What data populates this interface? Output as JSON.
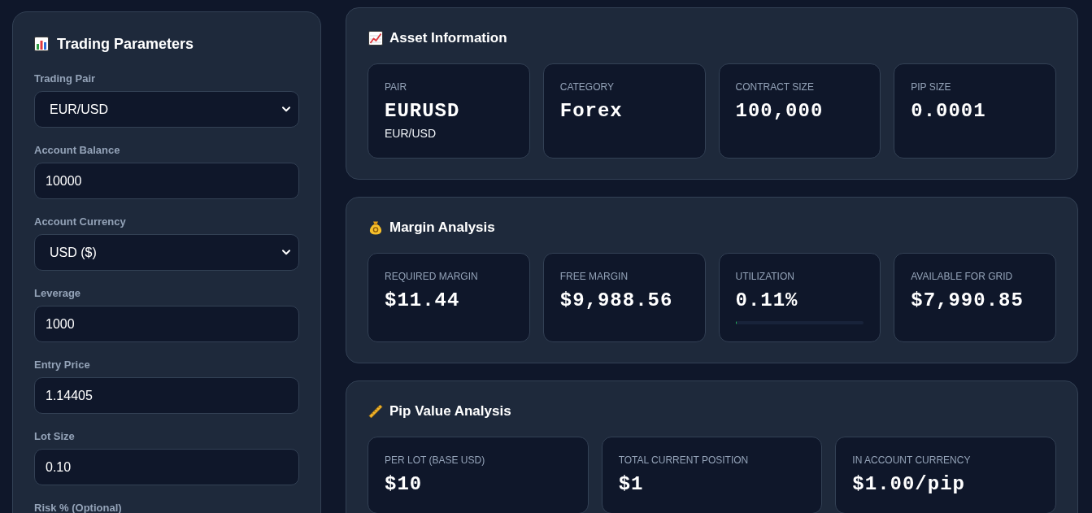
{
  "sidebar": {
    "title": "Trading Parameters",
    "fields": [
      {
        "kind": "select",
        "label": "Trading Pair",
        "value": "EUR/USD"
      },
      {
        "kind": "input",
        "label": "Account Balance",
        "value": "10000"
      },
      {
        "kind": "select",
        "label": "Account Currency",
        "value": "USD ($)"
      },
      {
        "kind": "input",
        "label": "Leverage",
        "value": "1000"
      },
      {
        "kind": "input",
        "label": "Entry Price",
        "value": "1.14405"
      },
      {
        "kind": "input",
        "label": "Lot Size",
        "value": "0.10"
      },
      {
        "kind": "label",
        "label": "Risk % (Optional)"
      }
    ]
  },
  "sections": [
    {
      "title": "Asset Information",
      "cards": [
        {
          "kind": "value_sub",
          "label": "PAIR",
          "value": "EURUSD",
          "sub": "EUR/USD"
        },
        {
          "kind": "value",
          "label": "CATEGORY",
          "value": "Forex"
        },
        {
          "kind": "value",
          "label": "CONTRACT SIZE",
          "value": "100,000"
        },
        {
          "kind": "value",
          "label": "PIP SIZE",
          "value": "0.0001"
        }
      ]
    },
    {
      "title": "Margin Analysis",
      "cards": [
        {
          "kind": "value",
          "label": "REQUIRED MARGIN",
          "value": "$11.44"
        },
        {
          "kind": "value",
          "label": "FREE MARGIN",
          "value": "$9,988.56"
        },
        {
          "kind": "meter",
          "label": "UTILIZATION",
          "value": "0.11%",
          "level": 0.0011
        },
        {
          "kind": "value",
          "label": "AVAILABLE FOR GRID",
          "value": "$7,990.85"
        }
      ]
    },
    {
      "title": "Pip Value Analysis",
      "cards": [
        {
          "kind": "value",
          "label": "PER LOT (BASE USD)",
          "value": "$10"
        },
        {
          "kind": "value",
          "label": "TOTAL CURRENT POSITION",
          "value": "$1"
        },
        {
          "kind": "value",
          "label": "IN ACCOUNT CURRENCY",
          "value": "$1.00/pip"
        }
      ]
    }
  ]
}
